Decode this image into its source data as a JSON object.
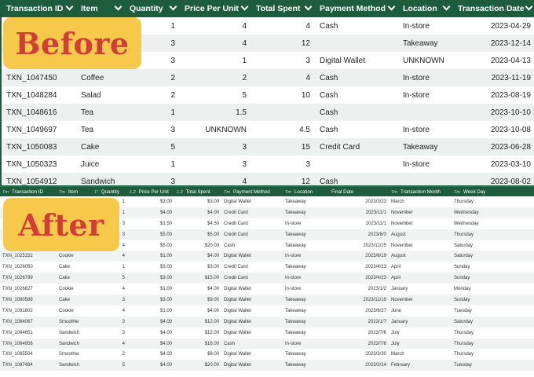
{
  "before": {
    "headers": [
      "Transaction ID",
      "Item",
      "Quantity",
      "Price Per Unit",
      "Total Spent",
      "Payment Method",
      "Location",
      "Transaction Date"
    ],
    "rows": [
      [
        "",
        "",
        "1",
        "4",
        "4",
        "Cash",
        "In-store",
        "2023-04-29"
      ],
      [
        "",
        "",
        "3",
        "4",
        "12",
        "",
        "Takeaway",
        "2023-12-14"
      ],
      [
        "",
        "",
        "3",
        "1",
        "3",
        "Digital Wallet",
        "UNKNOWN",
        "2023-04-13"
      ],
      [
        "TXN_1047450",
        "Coffee",
        "2",
        "2",
        "4",
        "Cash",
        "In-store",
        "2023-11-19"
      ],
      [
        "TXN_1048284",
        "Salad",
        "2",
        "5",
        "10",
        "Cash",
        "In-store",
        "2023-08-19"
      ],
      [
        "TXN_1048616",
        "Tea",
        "1",
        "1.5",
        "",
        "Cash",
        "",
        "2023-10-10"
      ],
      [
        "TXN_1049697",
        "Tea",
        "3",
        "UNKNOWN",
        "4.5",
        "Cash",
        "In-store",
        "2023-10-08"
      ],
      [
        "TXN_1050083",
        "Cake",
        "5",
        "3",
        "15",
        "Credit Card",
        "Takeaway",
        "2023-06-28"
      ],
      [
        "TXN_1050323",
        "Juice",
        "1",
        "3",
        "3",
        "",
        "In-store",
        "2023-03-10"
      ],
      [
        "TXN_1054912",
        "Sandwich",
        "3",
        "4",
        "12",
        "Cash",
        "",
        "2023-08-02"
      ]
    ]
  },
  "after": {
    "headers": [
      {
        "type": "Tт",
        "label": "Transaction ID"
      },
      {
        "type": "Tт",
        "label": "Item"
      },
      {
        "type": "1²",
        "label": "Quantity"
      },
      {
        "type": "1.2",
        "label": "Price Per Unit"
      },
      {
        "type": "1.2",
        "label": "Total Spent"
      },
      {
        "type": "Tт",
        "label": "Payment Method"
      },
      {
        "type": "Tт",
        "label": "Location"
      },
      {
        "type": "",
        "label": "Final Date"
      },
      {
        "type": "Tт",
        "label": "Transaction Month"
      },
      {
        "type": "Tт",
        "label": "Week Day"
      }
    ],
    "rows": [
      [
        "",
        "",
        "1",
        "$3.00",
        "$3.00",
        "Digital Wallet",
        "Takeaway",
        "2023/3/23",
        "March",
        "Thursday"
      ],
      [
        "",
        "",
        "1",
        "$4.00",
        "$4.00",
        "Credit Card",
        "Takeaway",
        "2023/11/1",
        "November",
        "Wednesday"
      ],
      [
        "",
        "",
        "3",
        "$1.50",
        "$4.50",
        "Credit Card",
        "In-store",
        "2023/11/1",
        "November",
        "Wednesday"
      ],
      [
        "",
        "",
        "3",
        "$5.00",
        "$5.00",
        "Credit Card",
        "Takeaway",
        "2023/8/3",
        "August",
        "Thursday"
      ],
      [
        "",
        "",
        "4",
        "$5.00",
        "$20.00",
        "Cash",
        "Takeaway",
        "2023/11/25",
        "November",
        "Saturday"
      ],
      [
        "TXN_1025152",
        "Cookie",
        "4",
        "$1.00",
        "$4.00",
        "Digital Wallet",
        "In-store",
        "2023/8/19",
        "August",
        "Saturday"
      ],
      [
        "TXN_1026050",
        "Cake",
        "1",
        "$3.00",
        "$3.00",
        "Credit Card",
        "Takeaway",
        "2023/4/23",
        "April",
        "Sunday"
      ],
      [
        "TXN_1026799",
        "Cake",
        "5",
        "$3.00",
        "$15.00",
        "Credit Card",
        "In-store",
        "2023/4/23",
        "April",
        "Sunday"
      ],
      [
        "TXN_1026827",
        "Cookie",
        "4",
        "$1.00",
        "$4.00",
        "Digital Wallet",
        "In-store",
        "2023/1/2",
        "January",
        "Monday"
      ],
      [
        "TXN_1080589",
        "Cake",
        "3",
        "$3.00",
        "$9.00",
        "Digital Wallet",
        "Takeaway",
        "2023/11/19",
        "November",
        "Sunday"
      ],
      [
        "TXN_1081802",
        "Cookie",
        "4",
        "$1.00",
        "$4.00",
        "Digital Wallet",
        "Takeaway",
        "2023/6/27",
        "June",
        "Tuesday"
      ],
      [
        "TXN_1084067",
        "Smoothie",
        "3",
        "$4.00",
        "$12.00",
        "Digital Wallet",
        "Takeaway",
        "2023/1/7",
        "January",
        "Saturday"
      ],
      [
        "TXN_1084651",
        "Sandwich",
        "3",
        "$4.00",
        "$12.00",
        "Digital Wallet",
        "Takeaway",
        "2023/7/6",
        "July",
        "Thursday"
      ],
      [
        "TXN_1084956",
        "Sandwich",
        "4",
        "$4.00",
        "$16.00",
        "Cash",
        "In-store",
        "2023/7/6",
        "July",
        "Thursday"
      ],
      [
        "TXN_1085504",
        "Smoothie",
        "2",
        "$4.00",
        "$8.00",
        "Digital Wallet",
        "Takeaway",
        "2023/3/30",
        "March",
        "Thursday"
      ],
      [
        "TXN_1087464",
        "Sandwich",
        "5",
        "$4.00",
        "$20.00",
        "Digital Wallet",
        "Takeaway",
        "2023/2/14",
        "February",
        "Tuesday"
      ],
      [
        "",
        "",
        "",
        "",
        "",
        "",
        "",
        "",
        "",
        ""
      ]
    ]
  },
  "badges": {
    "before": "Before",
    "after": "After"
  },
  "colors": {
    "header_bg": "#1d5c3c",
    "badge_bg": "#f6c94a",
    "badge_text": "#d13d37"
  }
}
